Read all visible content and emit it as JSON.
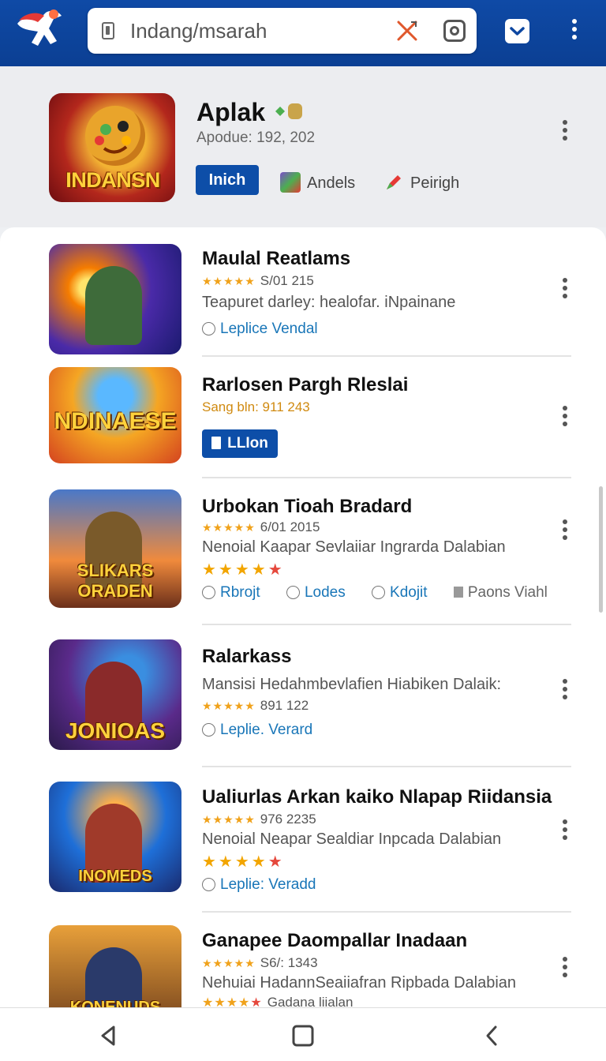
{
  "browser": {
    "address": "Indang/msarah",
    "accent": "#0d47a1"
  },
  "featured": {
    "icon_text": "INDANSN",
    "title": "Aplak",
    "subtitle": "Apodue: 192, 202",
    "install_label": "Inich",
    "chip1_label": "Andels",
    "chip2_label": "Peirigh"
  },
  "apps": [
    {
      "title": "Maulal Reatlams",
      "meta": "S/01 215",
      "desc": "Teapuret darley: healofar. iNpainane",
      "links": [
        "Leplice Vendal"
      ],
      "thumb_text": ""
    },
    {
      "title": "Rarlosen Pargh Rleslai",
      "meta": "Sang bln: 911 243",
      "button": "LLIon",
      "thumb_text": "NDINAESE"
    },
    {
      "title": "Urbokan Tioah Bradard",
      "meta": "6/01 2015",
      "desc": "Nenoial Kaapar Sevlaiiar Ingrarda Dalabian",
      "rating": 4,
      "links": [
        "Rbrojt",
        "Lodes",
        "Kdojit"
      ],
      "extra_link": "Paons Viahl",
      "thumb_text": "SLIKARS ORADEN"
    },
    {
      "title": "Ralarkass",
      "desc": "Mansisi Hedahmbevlafien Hiabiken Dalaik:",
      "meta": "891 122",
      "links": [
        "Leplie. Verard"
      ],
      "thumb_text": "JONIOAS"
    },
    {
      "title": "Ualiurlas Arkan kaiko Nlapap Riidansia",
      "meta": "976 2235",
      "desc": "Nenoial Neapar Sealdiar Inpcada Dalabian",
      "rating": 4,
      "links": [
        "Leplie: Veradd"
      ],
      "thumb_text": "INOMEDS"
    },
    {
      "title": "Ganapee Daompallar Inadaan",
      "meta": "S6/: 1343",
      "desc": "Nehuiai HadannSeaiiafran Ripbada Dalabian",
      "rating": 4,
      "tail": "Gadana liialan",
      "thumb_text": "KONENUDS"
    }
  ],
  "nav": {
    "back_icon": "triangle-back-icon",
    "home_icon": "square-home-icon",
    "recent_icon": "chevron-left-icon"
  }
}
